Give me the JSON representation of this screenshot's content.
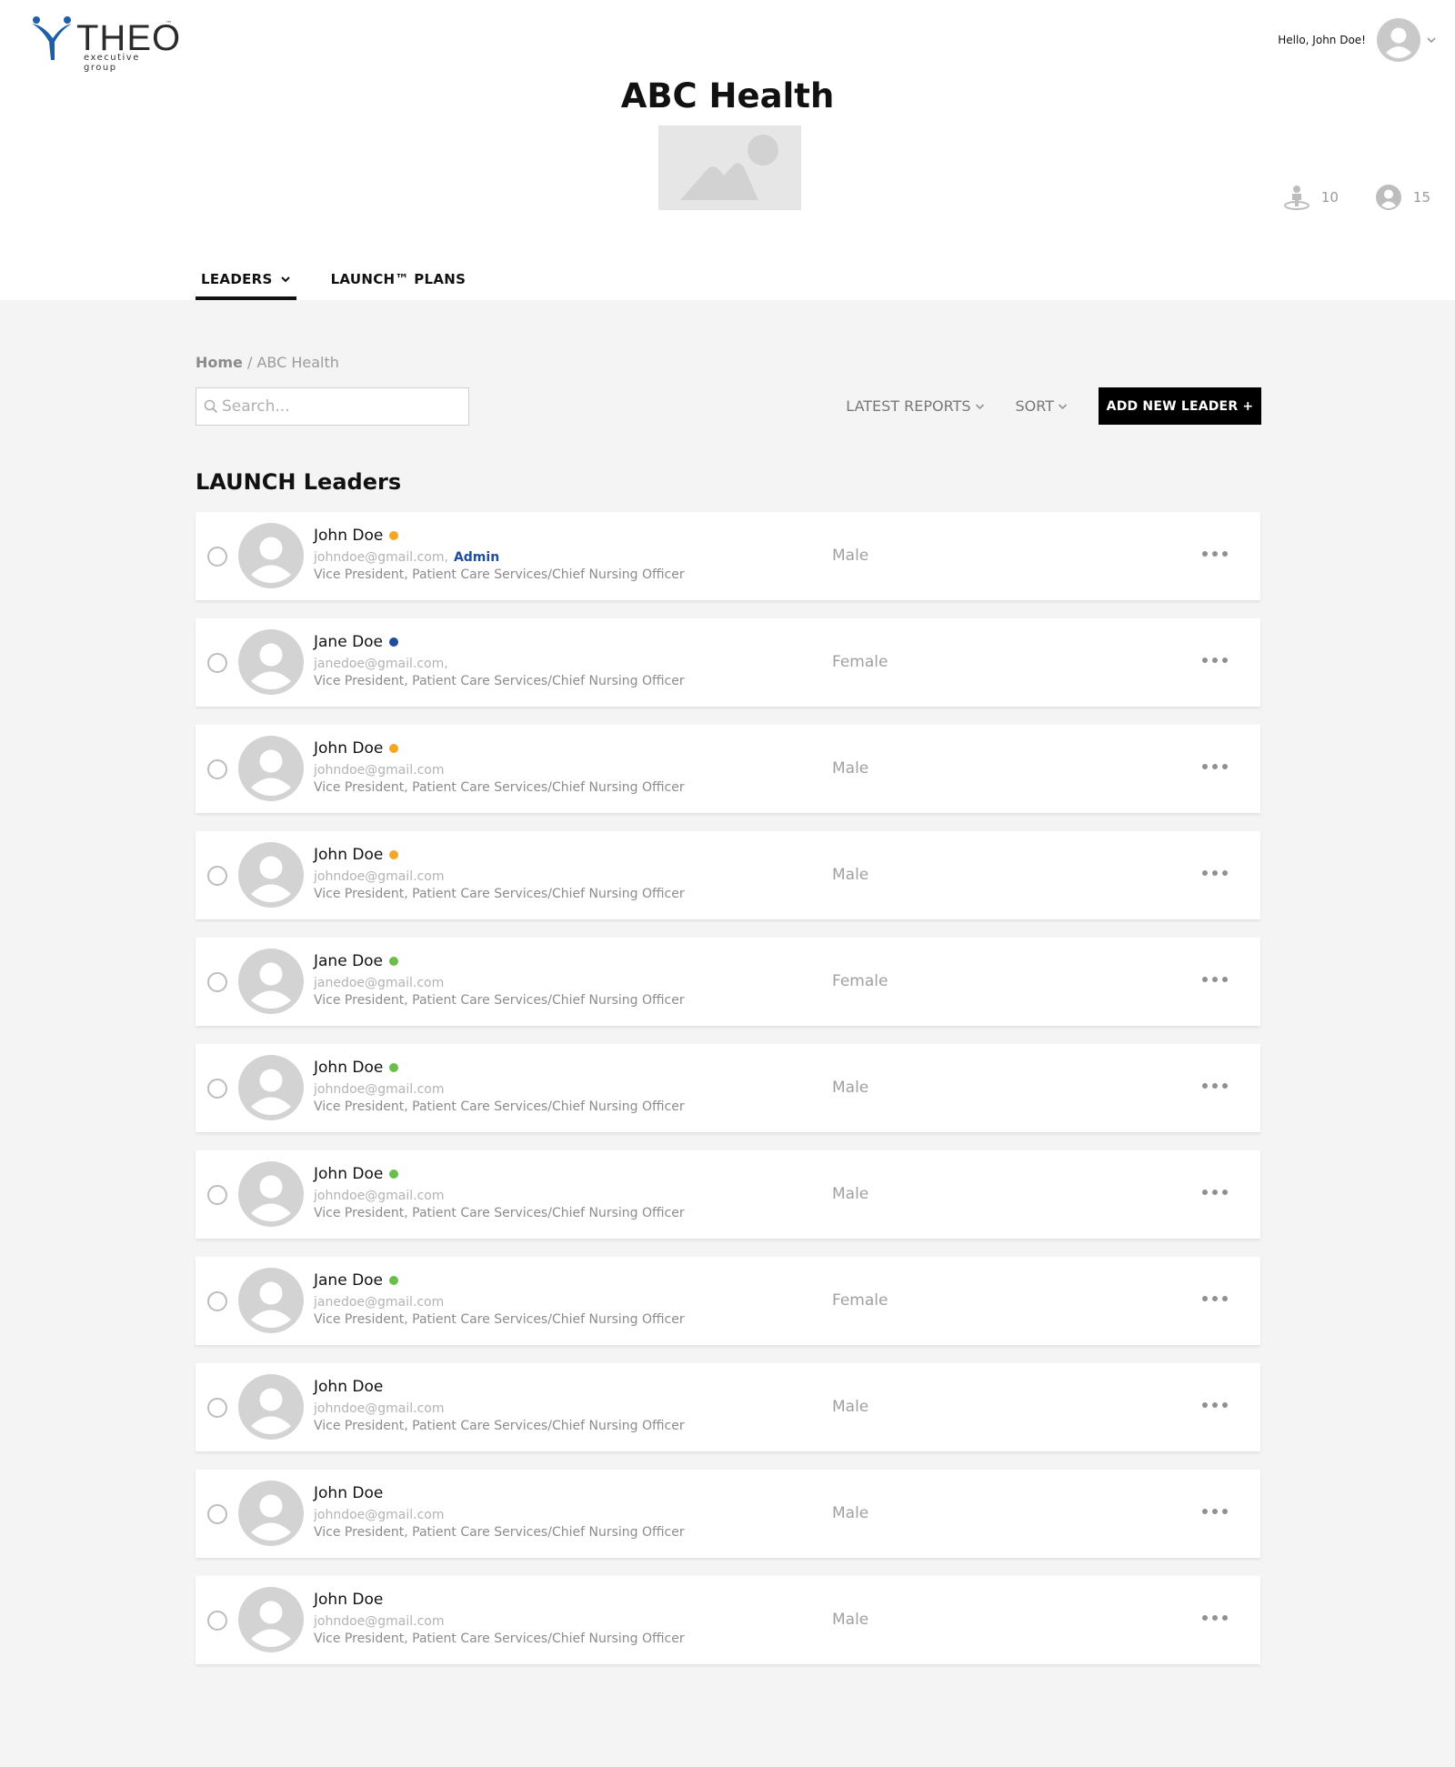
{
  "brand": {
    "name": "THEO",
    "trademark": "™",
    "tagline": "executive group",
    "accent_color": "#1f5fa8"
  },
  "user_menu": {
    "greeting": "Hello, John Doe!",
    "avatar_icon": "user-avatar-icon",
    "chevron_icon": "chevron-down-icon"
  },
  "organization": {
    "title": "ABC Health",
    "image_icon": "image-placeholder-icon"
  },
  "stats": [
    {
      "icon": "leader-pin-icon",
      "value": "10"
    },
    {
      "icon": "user-circle-icon",
      "value": "15"
    }
  ],
  "tabs": [
    {
      "label": "LEADERS",
      "active": true,
      "has_dropdown": true
    },
    {
      "label": "LAUNCH™ PLANS",
      "active": false,
      "has_dropdown": false
    }
  ],
  "breadcrumb": {
    "home": "Home",
    "separator": " / ",
    "current": "ABC Health"
  },
  "search": {
    "placeholder": "Search...",
    "value": ""
  },
  "toolbar": {
    "latest_reports_label": "LATEST REPORTS",
    "sort_label": "SORT",
    "add_button_label": "ADD NEW LEADER +"
  },
  "section_title": "LAUNCH Leaders",
  "status_colors": {
    "orange": "#f5a623",
    "blue": "#1f4e9c",
    "green": "#6abf4b"
  },
  "leaders": [
    {
      "name": "John Doe",
      "status": "orange",
      "email": "johndoe@gmail.com,",
      "role_badge": "Admin",
      "title": "Vice President, Patient Care Services/Chief Nursing Officer",
      "gender": "Male"
    },
    {
      "name": "Jane Doe",
      "status": "blue",
      "email": "janedoe@gmail.com,",
      "role_badge": "",
      "title": "Vice President, Patient Care Services/Chief Nursing Officer",
      "gender": "Female"
    },
    {
      "name": "John Doe",
      "status": "orange",
      "email": "johndoe@gmail.com",
      "role_badge": "",
      "title": "Vice President, Patient Care Services/Chief Nursing Officer",
      "gender": "Male"
    },
    {
      "name": "John Doe",
      "status": "orange",
      "email": "johndoe@gmail.com",
      "role_badge": "",
      "title": "Vice President, Patient Care Services/Chief Nursing Officer",
      "gender": "Male"
    },
    {
      "name": "Jane Doe",
      "status": "green",
      "email": "janedoe@gmail.com",
      "role_badge": "",
      "title": "Vice President, Patient Care Services/Chief Nursing Officer",
      "gender": "Female"
    },
    {
      "name": "John Doe",
      "status": "green",
      "email": "johndoe@gmail.com",
      "role_badge": "",
      "title": "Vice President, Patient Care Services/Chief Nursing Officer",
      "gender": "Male"
    },
    {
      "name": "John Doe",
      "status": "green",
      "email": "johndoe@gmail.com",
      "role_badge": "",
      "title": "Vice President, Patient Care Services/Chief Nursing Officer",
      "gender": "Male"
    },
    {
      "name": "Jane Doe",
      "status": "green",
      "email": "janedoe@gmail.com",
      "role_badge": "",
      "title": "Vice President, Patient Care Services/Chief Nursing Officer",
      "gender": "Female"
    },
    {
      "name": "John Doe",
      "status": "",
      "email": "johndoe@gmail.com",
      "role_badge": "",
      "title": "Vice President, Patient Care Services/Chief Nursing Officer",
      "gender": "Male"
    },
    {
      "name": "John Doe",
      "status": "",
      "email": "johndoe@gmail.com",
      "role_badge": "",
      "title": "Vice President, Patient Care Services/Chief Nursing Officer",
      "gender": "Male"
    },
    {
      "name": "John Doe",
      "status": "",
      "email": "johndoe@gmail.com",
      "role_badge": "",
      "title": "Vice President, Patient Care Services/Chief Nursing Officer",
      "gender": "Male"
    }
  ]
}
